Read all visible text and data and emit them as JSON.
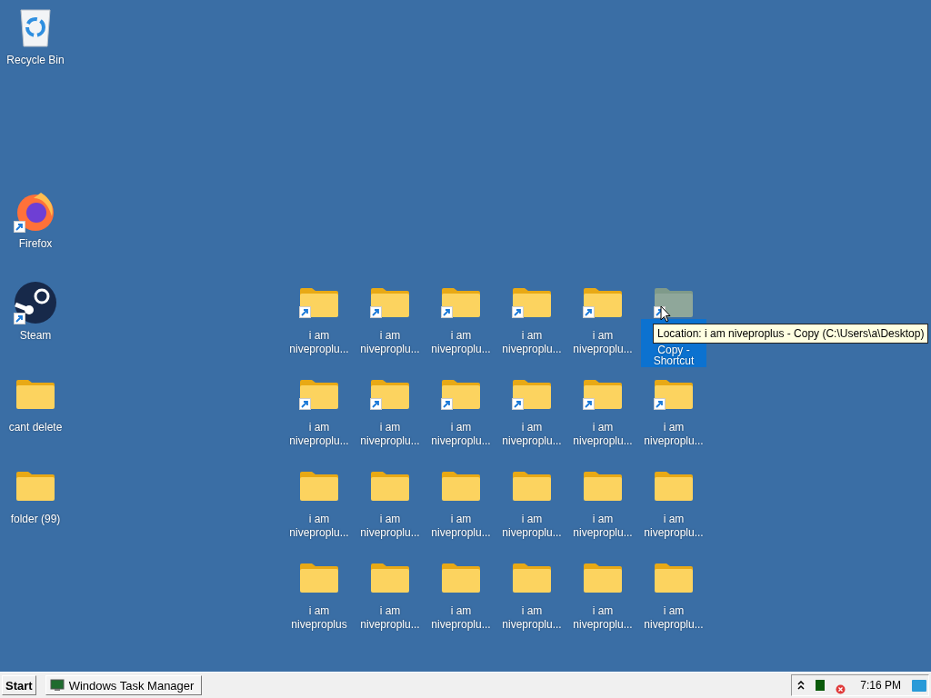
{
  "desktop": {
    "left_icons": [
      {
        "kind": "recycle-bin",
        "label": "Recycle Bin",
        "shortcut": false,
        "selected": false
      },
      {
        "kind": "firefox",
        "label": "Firefox",
        "shortcut": true,
        "selected": false
      },
      {
        "kind": "steam",
        "label": "Steam",
        "shortcut": true,
        "selected": false
      },
      {
        "kind": "folder",
        "label": "cant delete",
        "shortcut": false,
        "selected": false
      },
      {
        "kind": "folder",
        "label": "folder (99)",
        "shortcut": false,
        "selected": false
      }
    ],
    "grid": [
      [
        {
          "label": "i am niveproplu...",
          "shortcut": true,
          "selected": false
        },
        {
          "label": "i am niveproplu...",
          "shortcut": true,
          "selected": false
        },
        {
          "label": "i am niveproplu...",
          "shortcut": true,
          "selected": false
        },
        {
          "label": "i am niveproplu...",
          "shortcut": true,
          "selected": false
        },
        {
          "label": "i am niveproplu...",
          "shortcut": true,
          "selected": false
        },
        {
          "label": "Copy - Shortcut",
          "shortcut": true,
          "selected": true
        }
      ],
      [
        {
          "label": "i am niveproplu...",
          "shortcut": true,
          "selected": false
        },
        {
          "label": "i am niveproplu...",
          "shortcut": true,
          "selected": false
        },
        {
          "label": "i am niveproplu...",
          "shortcut": true,
          "selected": false
        },
        {
          "label": "i am niveproplu...",
          "shortcut": true,
          "selected": false
        },
        {
          "label": "i am niveproplu...",
          "shortcut": true,
          "selected": false
        },
        {
          "label": "i am niveproplu...",
          "shortcut": true,
          "selected": false
        }
      ],
      [
        {
          "label": "i am niveproplu...",
          "shortcut": false,
          "selected": false
        },
        {
          "label": "i am niveproplu...",
          "shortcut": false,
          "selected": false
        },
        {
          "label": "i am niveproplu...",
          "shortcut": false,
          "selected": false
        },
        {
          "label": "i am niveproplu...",
          "shortcut": false,
          "selected": false
        },
        {
          "label": "i am niveproplu...",
          "shortcut": false,
          "selected": false
        },
        {
          "label": "i am niveproplu...",
          "shortcut": false,
          "selected": false
        }
      ],
      [
        {
          "label": "i am niveproplus",
          "shortcut": false,
          "selected": false
        },
        {
          "label": "i am niveproplu...",
          "shortcut": false,
          "selected": false
        },
        {
          "label": "i am niveproplu...",
          "shortcut": false,
          "selected": false
        },
        {
          "label": "i am niveproplu...",
          "shortcut": false,
          "selected": false
        },
        {
          "label": "i am niveproplu...",
          "shortcut": false,
          "selected": false
        },
        {
          "label": "i am niveproplu...",
          "shortcut": false,
          "selected": false
        }
      ]
    ],
    "tooltip": {
      "text": "Location: i am niveproplus - Copy (C:\\Users\\a\\Desktop)"
    }
  },
  "taskbar": {
    "start": "Start",
    "tasks": [
      {
        "label": "Windows Task Manager"
      }
    ],
    "tray": {
      "time": "7:16 PM"
    }
  }
}
